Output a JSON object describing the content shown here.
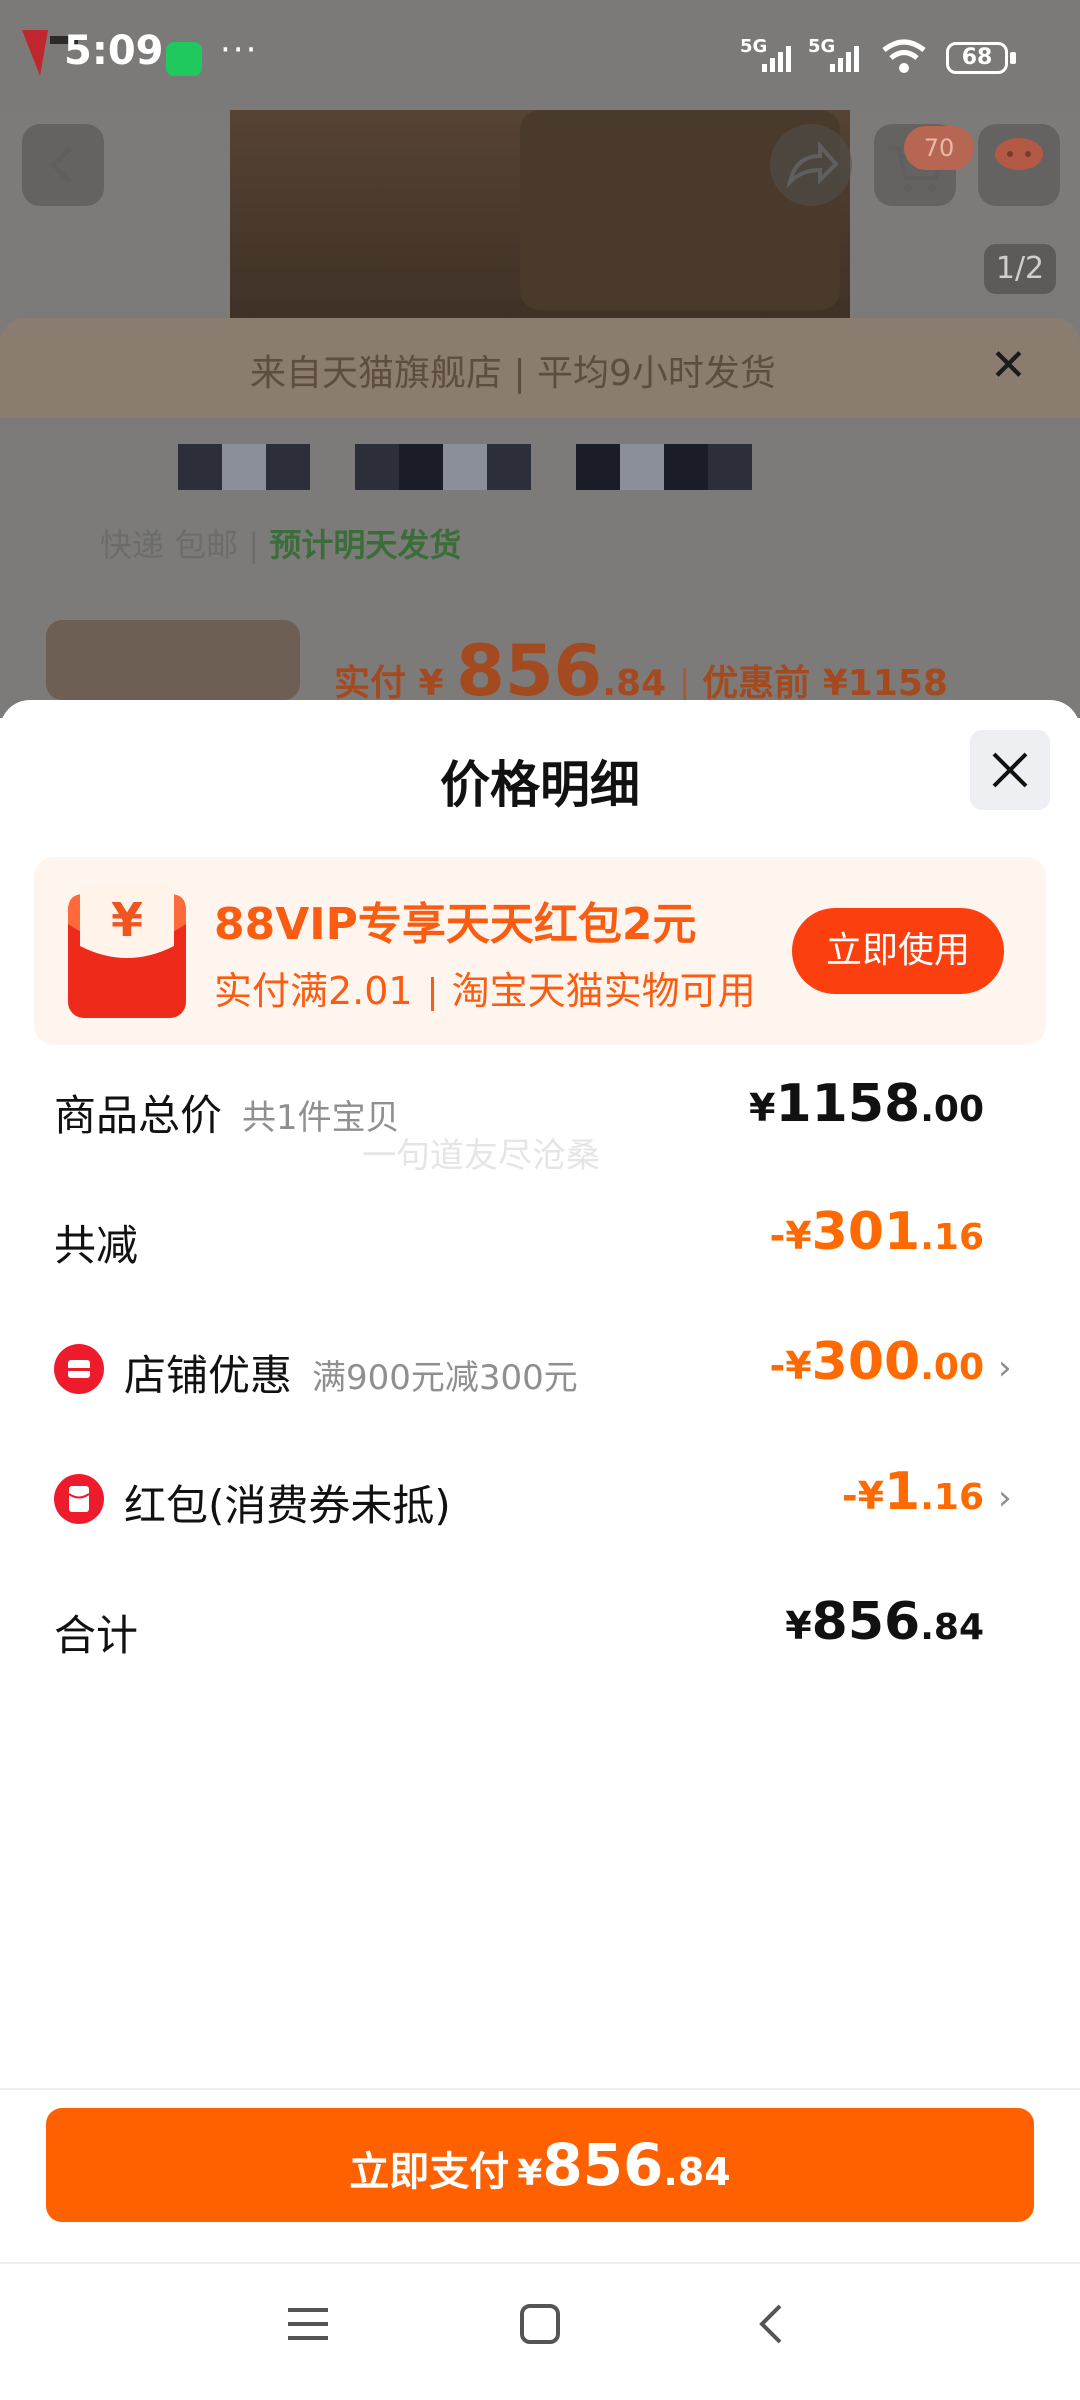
{
  "status_bar": {
    "time": "5:09",
    "more": "···",
    "signal_1": "5G",
    "signal_2": "5G",
    "battery": "68"
  },
  "product_page": {
    "cart_count": "70",
    "image_index": "1/2",
    "store_banner": "来自天猫旗舰店 | 平均9小时发货",
    "shipping_text": "快递 包邮",
    "delivery_text": "预计明天发货",
    "paid_label": "实付 ¥",
    "paid_int": "856",
    "paid_dec": ".84",
    "before_discount": "优惠前 ¥1158"
  },
  "sheet": {
    "title": "价格明细",
    "watermark": "一句道友尽沧桑"
  },
  "promo": {
    "title": "88VIP专享天天红包2元",
    "sub_left": "实付满2.01",
    "sub_right": "淘宝天猫实物可用",
    "button": "立即使用",
    "icon_glyph": "¥"
  },
  "rows": {
    "total": {
      "label": "商品总价",
      "sub": "共1件宝贝",
      "cur": "¥",
      "int": "1158",
      "dec": ".00"
    },
    "reduce": {
      "label": "共减",
      "cur": "-¥",
      "int": "301",
      "dec": ".16"
    },
    "store": {
      "label": "店铺优惠",
      "sub": "满900元减300元",
      "cur": "-¥",
      "int": "300",
      "dec": ".00"
    },
    "redpack": {
      "label": "红包(消费券未抵)",
      "cur": "-¥",
      "int": "1",
      "dec": ".16"
    },
    "sum": {
      "label": "合计",
      "cur": "¥",
      "int": "856",
      "dec": ".84"
    }
  },
  "pay": {
    "label": "立即支付",
    "cur": "¥",
    "int": "856",
    "dec": ".84"
  },
  "colors": {
    "accent": "#ff6000",
    "promo_text": "#fa5d12",
    "discount": "#ff6a00"
  }
}
